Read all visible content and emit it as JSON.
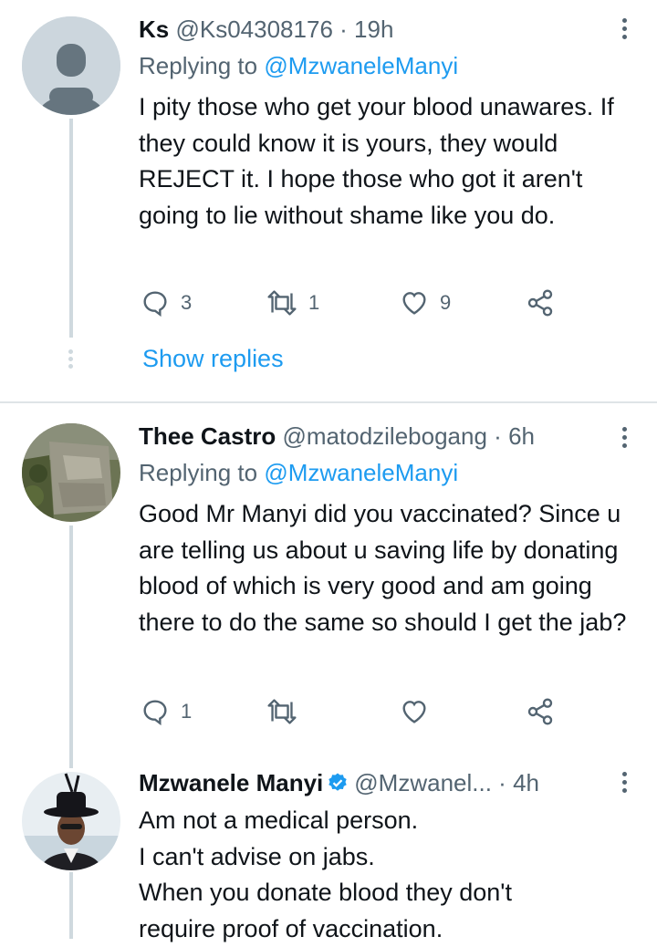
{
  "tweets": [
    {
      "name": "Ks",
      "handle": "@Ks04308176",
      "separator": "·",
      "time": "19h",
      "replying_prefix": "Replying to",
      "replying_to": "@MzwaneleManyi",
      "text": "I pity those who get your blood unawares. If they could know it is yours, they would REJECT it. I hope those who got it aren't going to lie without shame like you do.",
      "replies": "3",
      "retweets": "1",
      "likes": "9",
      "show_replies": "Show replies"
    },
    {
      "name": "Thee Castro",
      "handle": "@matodzilebogang",
      "separator": "·",
      "time": "6h",
      "replying_prefix": "Replying to",
      "replying_to": "@MzwaneleManyi",
      "text": "Good Mr Manyi did you vaccinated? Since u are telling us about u saving life by donating blood of which is very good and am going there to do the same so should I get the jab?",
      "replies": "1",
      "retweets": "",
      "likes": ""
    },
    {
      "name": "Mzwanele Manyi",
      "handle": "@Mzwanel...",
      "separator": "·",
      "time": "4h",
      "text_lines": [
        "Am not a medical person.",
        "I can't advise on jabs.",
        "When you donate blood they don't",
        "require proof of vaccination."
      ]
    }
  ],
  "colors": {
    "accent": "#1d9bf0",
    "secondary": "#536471",
    "line": "#cfd9de"
  },
  "icons": [
    "more-icon",
    "reply-icon",
    "retweet-icon",
    "like-icon",
    "share-icon",
    "verified-badge-icon"
  ]
}
